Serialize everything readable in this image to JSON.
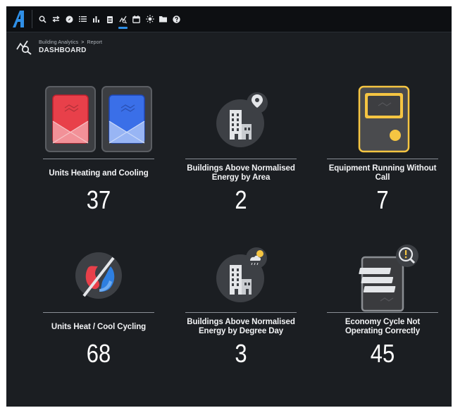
{
  "nav": {
    "items": [
      {
        "icon": "search-icon",
        "name": "nav-search"
      },
      {
        "icon": "swap-icon",
        "name": "nav-swap"
      },
      {
        "icon": "compass-icon",
        "name": "nav-explore"
      },
      {
        "icon": "list-icon",
        "name": "nav-list"
      },
      {
        "icon": "bar-chart-icon",
        "name": "nav-charts"
      },
      {
        "icon": "clipboard-icon",
        "name": "nav-clipboard"
      },
      {
        "icon": "analytics-icon",
        "name": "nav-analytics",
        "active": true
      },
      {
        "icon": "calendar-icon",
        "name": "nav-calendar"
      },
      {
        "icon": "sun-icon",
        "name": "nav-weather"
      },
      {
        "icon": "folder-icon",
        "name": "nav-files"
      },
      {
        "icon": "help-icon",
        "name": "nav-help"
      }
    ],
    "active_color": "#2f8fe6"
  },
  "header": {
    "breadcrumb_root": "Building Analytics",
    "breadcrumb_sep": ">",
    "breadcrumb_current": "Report",
    "title": "DASHBOARD"
  },
  "tiles": [
    {
      "label": "Units Heating and Cooling",
      "value": "37",
      "icon": "heating-cooling-units-icon"
    },
    {
      "label": "Buildings Above Normalised Energy by Area",
      "value": "2",
      "icon": "building-area-icon"
    },
    {
      "label": "Equipment Running Without Call",
      "value": "7",
      "icon": "equipment-running-icon"
    },
    {
      "label": "Units Heat / Cool Cycling",
      "value": "68",
      "icon": "heat-cool-cycling-icon"
    },
    {
      "label": "Buildings Above Normalised Energy by Degree Day",
      "value": "3",
      "icon": "building-degree-day-icon"
    },
    {
      "label": "Economy Cycle Not Operating Correctly",
      "value": "45",
      "icon": "economy-cycle-icon"
    }
  ],
  "colors": {
    "background": "#1b1e22",
    "topbar": "#0d0f12",
    "heating": "#e8404a",
    "cooling": "#3a6fe8",
    "warning": "#f5c542",
    "frame": "#55585d"
  }
}
